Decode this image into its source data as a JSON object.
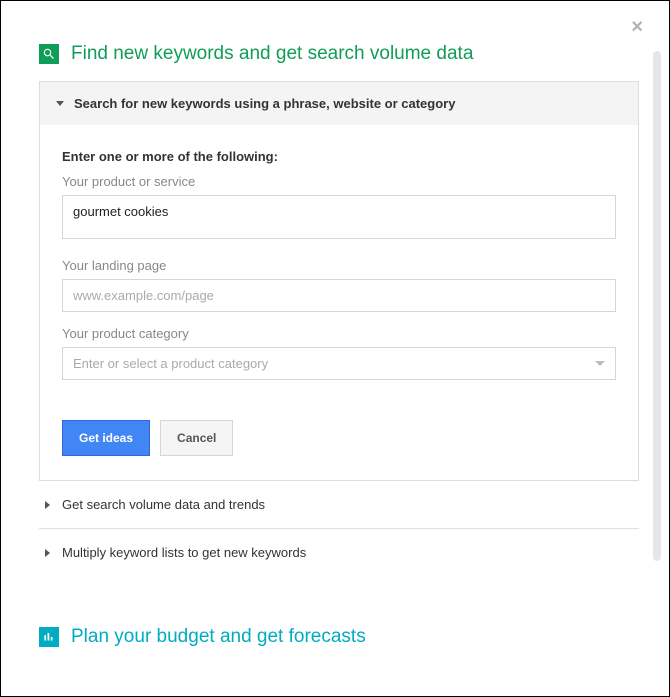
{
  "close_symbol": "×",
  "section1": {
    "title": "Find new keywords and get search volume data",
    "panel": {
      "header": "Search for new keywords using a phrase, website or category",
      "instruction": "Enter one or more of the following:",
      "product_label": "Your product or service",
      "product_value": "gourmet cookies",
      "landing_label": "Your landing page",
      "landing_placeholder": "www.example.com/page",
      "category_label": "Your product category",
      "category_placeholder": "Enter or select a product category",
      "get_ideas_label": "Get ideas",
      "cancel_label": "Cancel"
    },
    "sub_items": [
      "Get search volume data and trends",
      "Multiply keyword lists to get new keywords"
    ]
  },
  "section2": {
    "title": "Plan your budget and get forecasts"
  }
}
